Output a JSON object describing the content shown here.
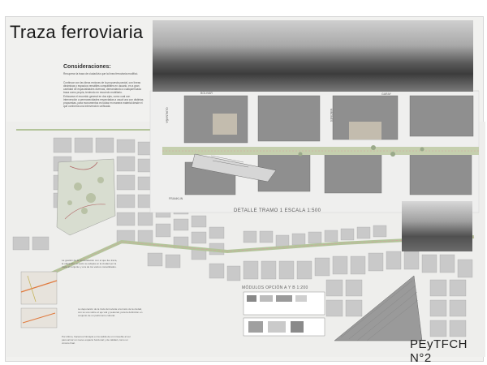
{
  "board": {
    "title": "Traza ferroviaria",
    "considerations_heading": "Consideraciones:",
    "paragraphs": [
      "Recuperar la traza de ciudad/vía que la línea ferroviaria modificó.",
      "Continuar con las ideas rectoras de la propuesta parcial, con líneas dinámicas y espacios versátiles compatibles en usuario, en a gran cantidad de espacialidades diversas, demandando a cualquier/cada traza como propia, teniendo en recuerdo mobiliario.",
      "Enfocarse el recorrido general en dos ejes, como cual con intervención a permanecidades respectadas a usual una con distintas propuestas, para monumentos es todas en manera material desde el que conforma una intervención unificada."
    ],
    "street_labels": [
      "BOLIVAR",
      "GARAY",
      "GUALNAÑA",
      "MIÑONES",
      "FRANKLIN"
    ],
    "detail_label": "DETALLE TRAMO 1 ESCALA 1:500",
    "modules_label": "MÓDULOS OPCIÓN A Y B 1:200",
    "lower_text": [
      "La gestión de la consolidación con el que fue traza, la ubicación, el vacío se adapta en la ciudad por la traza al conjunto y a la de los vacíos consolidados.",
      "La depuración de la traza ferroviaria a la traza de la ciudad, con su uso sobre el eje vial y peatonal, para la definición en conjunto de un patrimonio cultural.",
      "Por último, hacemos hincapié en la salida de un inmueble al sur para armar un nuevo espacio funcional y de calidad, como un vínculo final."
    ],
    "brand": "PEyTFCH N°2"
  }
}
